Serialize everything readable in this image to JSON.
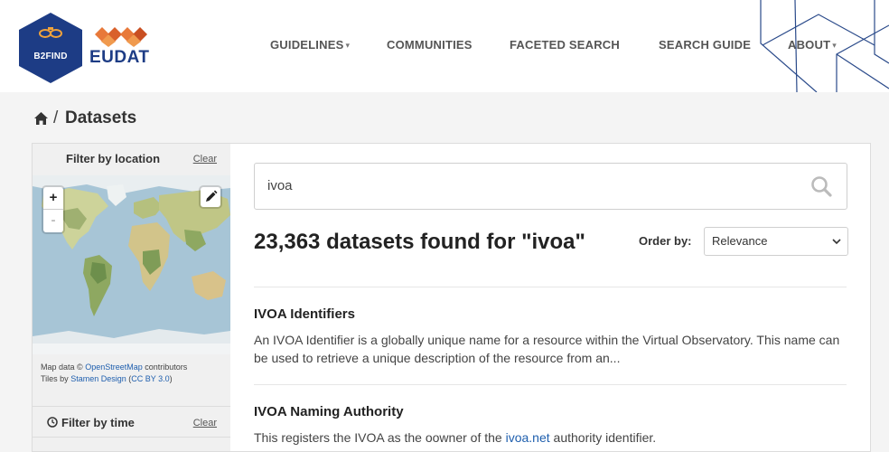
{
  "header": {
    "logo_b2find": "B2FIND",
    "logo_eudat": "EUDAT",
    "nav": [
      {
        "label": "GUIDELINES",
        "has_dropdown": true
      },
      {
        "label": "COMMUNITIES",
        "has_dropdown": false
      },
      {
        "label": "FACETED SEARCH",
        "has_dropdown": false
      },
      {
        "label": "SEARCH GUIDE",
        "has_dropdown": false
      },
      {
        "label": "ABOUT",
        "has_dropdown": true
      }
    ],
    "caret_glyph": "▾"
  },
  "breadcrumb": {
    "icon": "home-icon",
    "separator": "/",
    "current": "Datasets"
  },
  "sidebar": {
    "location_filter": {
      "title": "Filter by location",
      "clear_label": "Clear",
      "zoom_in": "+",
      "zoom_out": "-",
      "draw_icon": "pencil-icon"
    },
    "map_credits": {
      "line1_prefix": "Map data ©",
      "line1_link": "OpenStreetMap",
      "line1_suffix": "contributors",
      "line2_prefix": "Tiles by",
      "line2_link": "Stamen Design",
      "line2_paren_open": "(",
      "line2_license": "CC BY 3.0",
      "line2_paren_close": ")"
    },
    "time_filter": {
      "title": "Filter by time",
      "clear_label": "Clear",
      "icon": "clock-icon"
    }
  },
  "search": {
    "query": "ivoa",
    "icon": "search-icon"
  },
  "results": {
    "count_text": "23,363 datasets found for \"ivoa\"",
    "order_label": "Order by:",
    "order_selected": "Relevance",
    "items": [
      {
        "title": "IVOA Identifiers",
        "description": "An IVOA Identifier is a globally unique name for a resource within the Virtual Observatory. This name can be used to retrieve a unique description of the resource from an..."
      },
      {
        "title": "IVOA Naming Authority",
        "description_prefix": "This registers the IVOA as the oowner of the",
        "description_link": "ivoa.net",
        "description_suffix": "authority identifier."
      }
    ]
  },
  "colors": {
    "brand_blue": "#1d3c85",
    "link_blue": "#1f5fae",
    "logo_orange": "#e8793a"
  }
}
